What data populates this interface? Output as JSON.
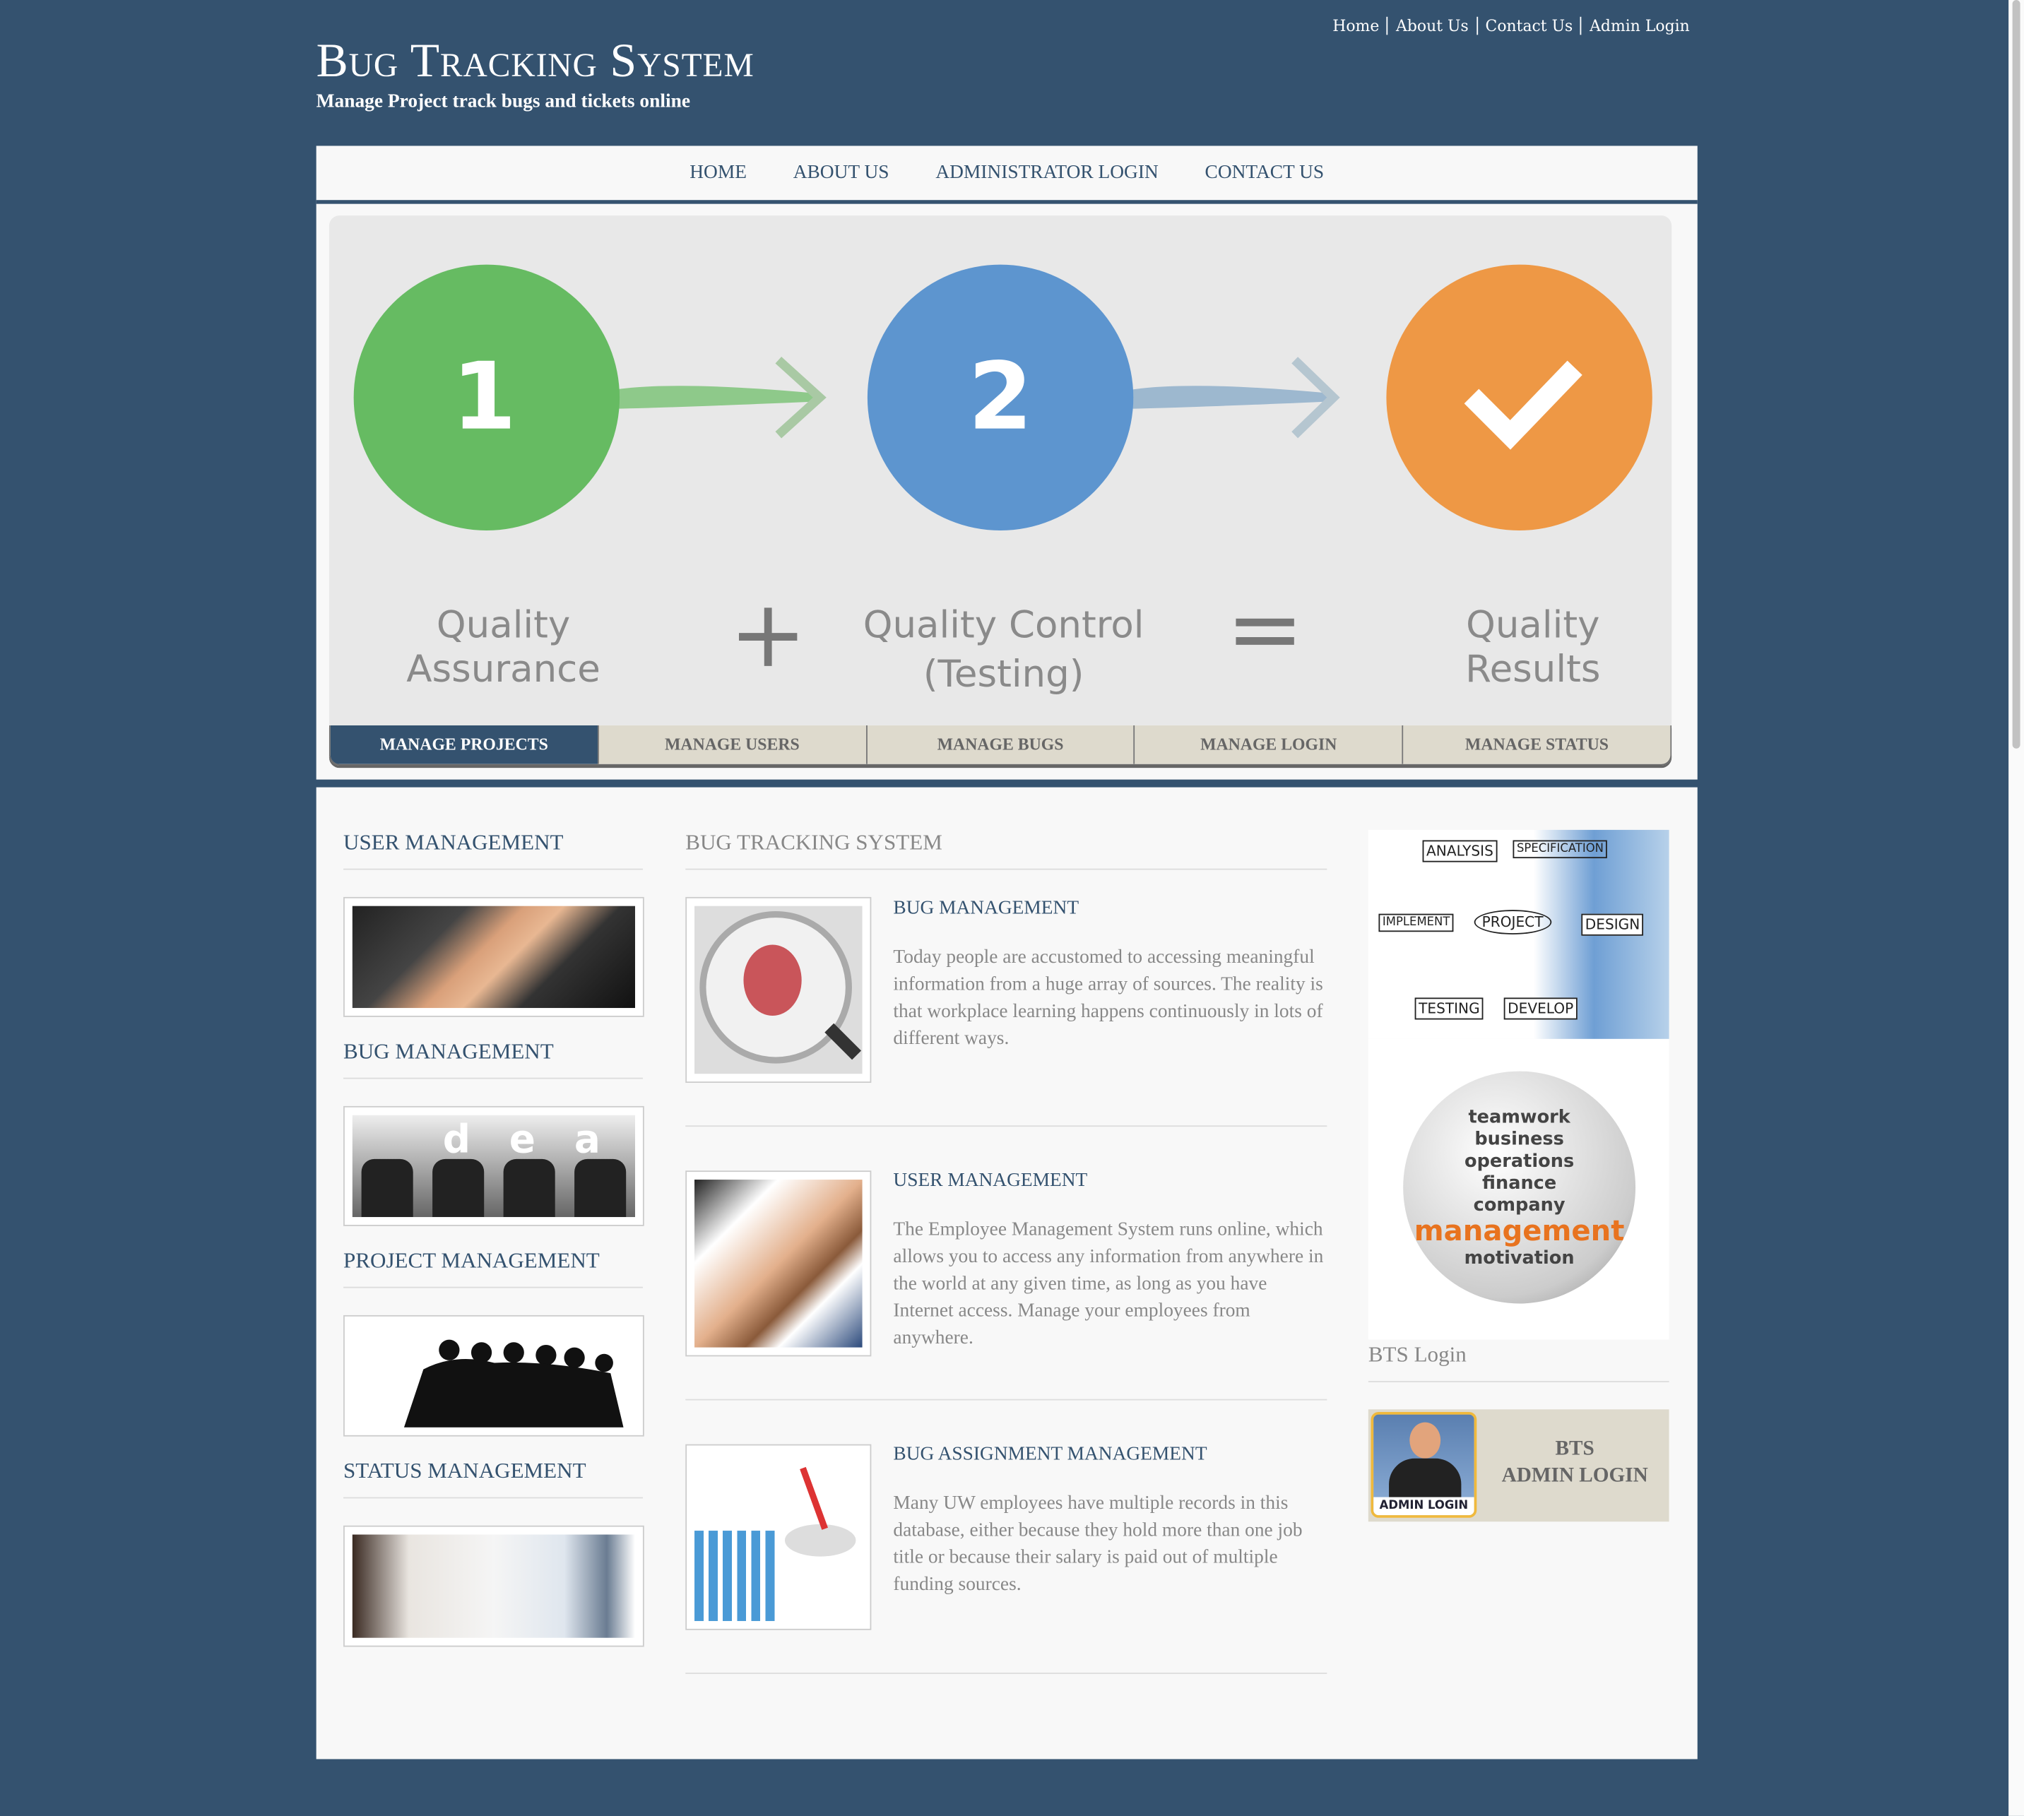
{
  "header": {
    "title": "Bug Tracking System",
    "subtitle": "Manage Project track bugs and tickets online",
    "top_links": [
      "Home",
      "About Us",
      "Contact Us",
      "Admin Login"
    ]
  },
  "nav": [
    "HOME",
    "ABOUT US",
    "ADMINISTRATOR LOGIN",
    "CONTACT US"
  ],
  "banner": {
    "step1": "1",
    "step2": "2",
    "qa": "Quality Assurance",
    "plus": "+",
    "qc1": "Quality Control",
    "qc2": "(Testing)",
    "equals": "=",
    "results": "Quality Results"
  },
  "tabs": [
    "MANAGE PROJECTS",
    "MANAGE USERS",
    "MANAGE BUGS",
    "MANAGE LOGIN",
    "MANAGE STATUS"
  ],
  "left": [
    "USER MANAGEMENT",
    "BUG MANAGEMENT",
    "PROJECT MANAGEMENT",
    "STATUS MANAGEMENT"
  ],
  "idea_letters": [
    "d",
    "e",
    "a"
  ],
  "center": {
    "heading": "BUG TRACKING SYSTEM",
    "items": [
      {
        "title": "BUG MANAGEMENT",
        "text": "Today people are accustomed to accessing meaningful information from a huge array of sources. The reality is that workplace learning happens continuously in lots of different ways."
      },
      {
        "title": "USER MANAGEMENT",
        "text": "The Employee Management System runs online, which allows you to access any information from anywhere in the world at any given time, as long as you have Internet access. Manage your employees from anywhere."
      },
      {
        "title": "BUG ASSIGNMENT MANAGEMENT",
        "text": "Many UW employees have multiple records in this database, either because they hold more than one job title or because their salary is paid out of multiple funding sources."
      }
    ]
  },
  "right": {
    "diagram_labels": [
      "ANALYSIS",
      "SPECIFICATION",
      "IMPLEMENT",
      "PROJECT",
      "DESIGN",
      "TESTING",
      "DEVELOP"
    ],
    "sphere_words": [
      "teamwork",
      "business",
      "operations",
      "finance",
      "company",
      "management",
      "motivation"
    ],
    "login_heading": "BTS Login",
    "admin_badge": "ADMIN LOGIN",
    "admin_line1": "BTS",
    "admin_line2": "ADMIN LOGIN"
  },
  "colors": {
    "brand": "#34526f",
    "tab_bg": "#dedacd",
    "green": "#5cb85c",
    "blue": "#5b93cf",
    "orange": "#ef9a45"
  }
}
